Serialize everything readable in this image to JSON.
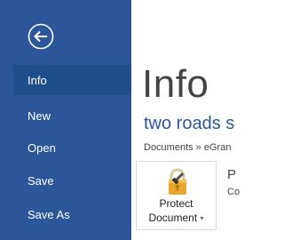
{
  "colors": {
    "sidebar_bg": "#2b579a",
    "active_item_bg": "#1e4e8c",
    "accent": "#2b579a",
    "lock": "#e8a62b"
  },
  "sidebar": {
    "back_icon": "back-arrow-circle-icon",
    "items": [
      {
        "label": "Info",
        "active": true
      },
      {
        "label": "New",
        "active": false
      },
      {
        "label": "Open",
        "active": false
      },
      {
        "label": "Save",
        "active": false
      },
      {
        "label": "Save As",
        "active": false
      }
    ]
  },
  "main": {
    "title": "Info",
    "document_name": "two roads s",
    "path": "Documents » eGran",
    "protect": {
      "icon": "lock-key-icon",
      "label_line1": "Protect",
      "label_line2": "Document",
      "caret": "▾",
      "title": "P",
      "description": "Co"
    }
  }
}
